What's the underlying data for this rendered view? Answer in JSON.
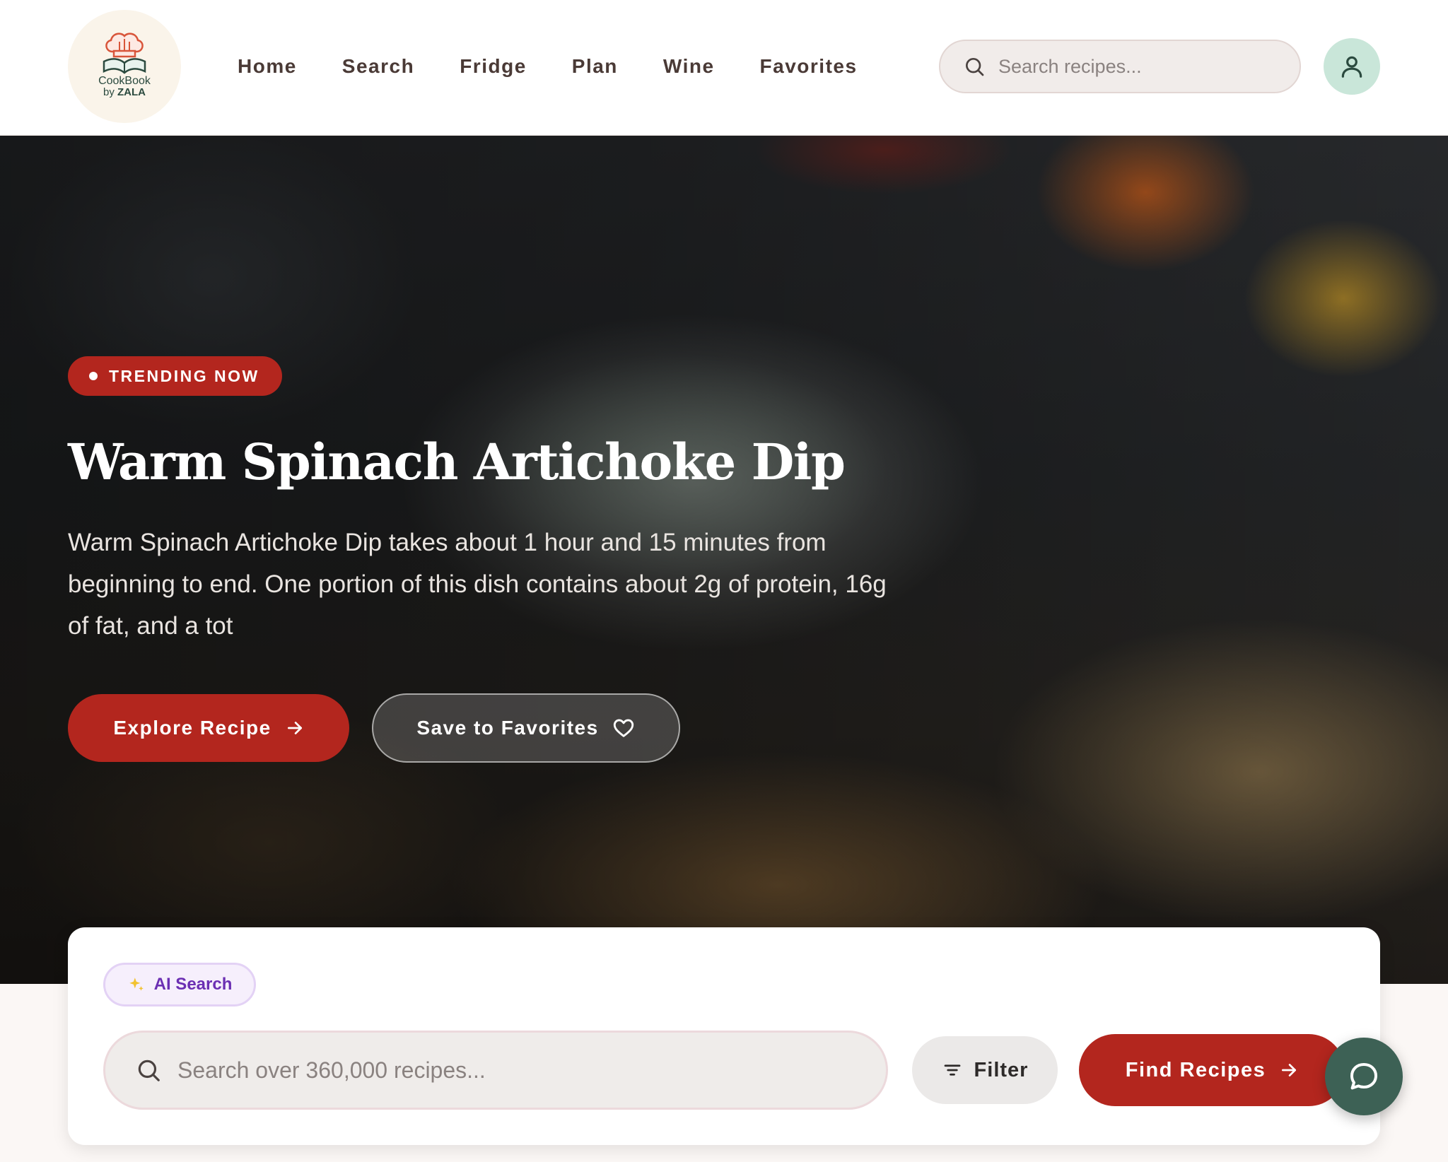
{
  "brand": {
    "logo_line1": "CookBook",
    "logo_line2_prefix": "by",
    "logo_line2_name": "ZALA"
  },
  "nav": {
    "items": [
      {
        "label": "Home"
      },
      {
        "label": "Search"
      },
      {
        "label": "Fridge"
      },
      {
        "label": "Plan"
      },
      {
        "label": "Wine"
      },
      {
        "label": "Favorites"
      }
    ]
  },
  "header_search": {
    "placeholder": "Search recipes...",
    "icon": "search-icon"
  },
  "user": {
    "icon": "user-icon"
  },
  "hero": {
    "badge": "TRENDING NOW",
    "title": "Warm Spinach Artichoke Dip",
    "description": "Warm Spinach Artichoke Dip takes about 1 hour and 15 minutes from beginning to end. One portion of this dish contains about 2g of protein, 16g of fat, and a tot",
    "explore_label": "Explore Recipe",
    "save_label": "Save to Favorites"
  },
  "search_card": {
    "ai_chip_label": "AI Search",
    "placeholder": "Search over 360,000 recipes...",
    "filter_label": "Filter",
    "find_label": "Find Recipes"
  },
  "colors": {
    "accent_red": "#b3261e",
    "chat_green": "#3d6155",
    "ai_purple": "#6b2fb3",
    "avatar_mint": "#c9e6d9"
  }
}
